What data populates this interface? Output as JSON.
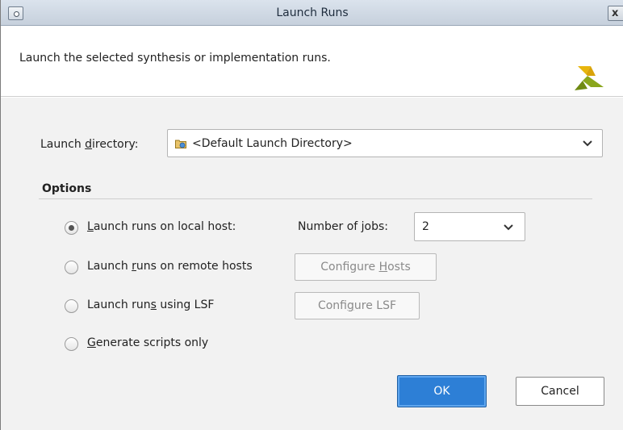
{
  "window": {
    "title": "Launch Runs",
    "close_glyph": "x"
  },
  "header": {
    "description": "Launch the selected synthesis or implementation runs."
  },
  "launch_directory": {
    "label_pre": "Launch ",
    "label_mnemonic": "d",
    "label_post": "irectory:",
    "value": "<Default Launch Directory>"
  },
  "options": {
    "title": "Options",
    "local": {
      "pre": "",
      "mnemonic": "L",
      "post": "aunch runs on local host:",
      "checked": true
    },
    "jobs_label_pre": "Number of ",
    "jobs_label_mnemonic": "j",
    "jobs_label_post": "obs:",
    "jobs_value": "2",
    "remote": {
      "pre": "Launch ",
      "mnemonic": "r",
      "post": "uns on remote hosts",
      "checked": false
    },
    "configure_hosts": {
      "pre": "Configure ",
      "mnemonic": "H",
      "post": "osts"
    },
    "lsf": {
      "pre": "Launch run",
      "mnemonic": "s",
      "post": " using LSF",
      "checked": false
    },
    "configure_lsf": {
      "pre": "Confi",
      "mnemonic": "g",
      "post": "ure LSF"
    },
    "scripts": {
      "pre": "",
      "mnemonic": "G",
      "post": "enerate scripts only",
      "checked": false
    }
  },
  "buttons": {
    "ok": "OK",
    "cancel": "Cancel"
  },
  "colors": {
    "accent": "#2d7fd6",
    "logo_green": "#8aa61c",
    "logo_yellow": "#e8b50c"
  },
  "icons": {
    "window_menu": "window-menu-icon",
    "close": "close-icon",
    "logo": "xilinx-logo-icon",
    "folder": "folder-icon",
    "dropdown": "chevron-down-icon"
  }
}
